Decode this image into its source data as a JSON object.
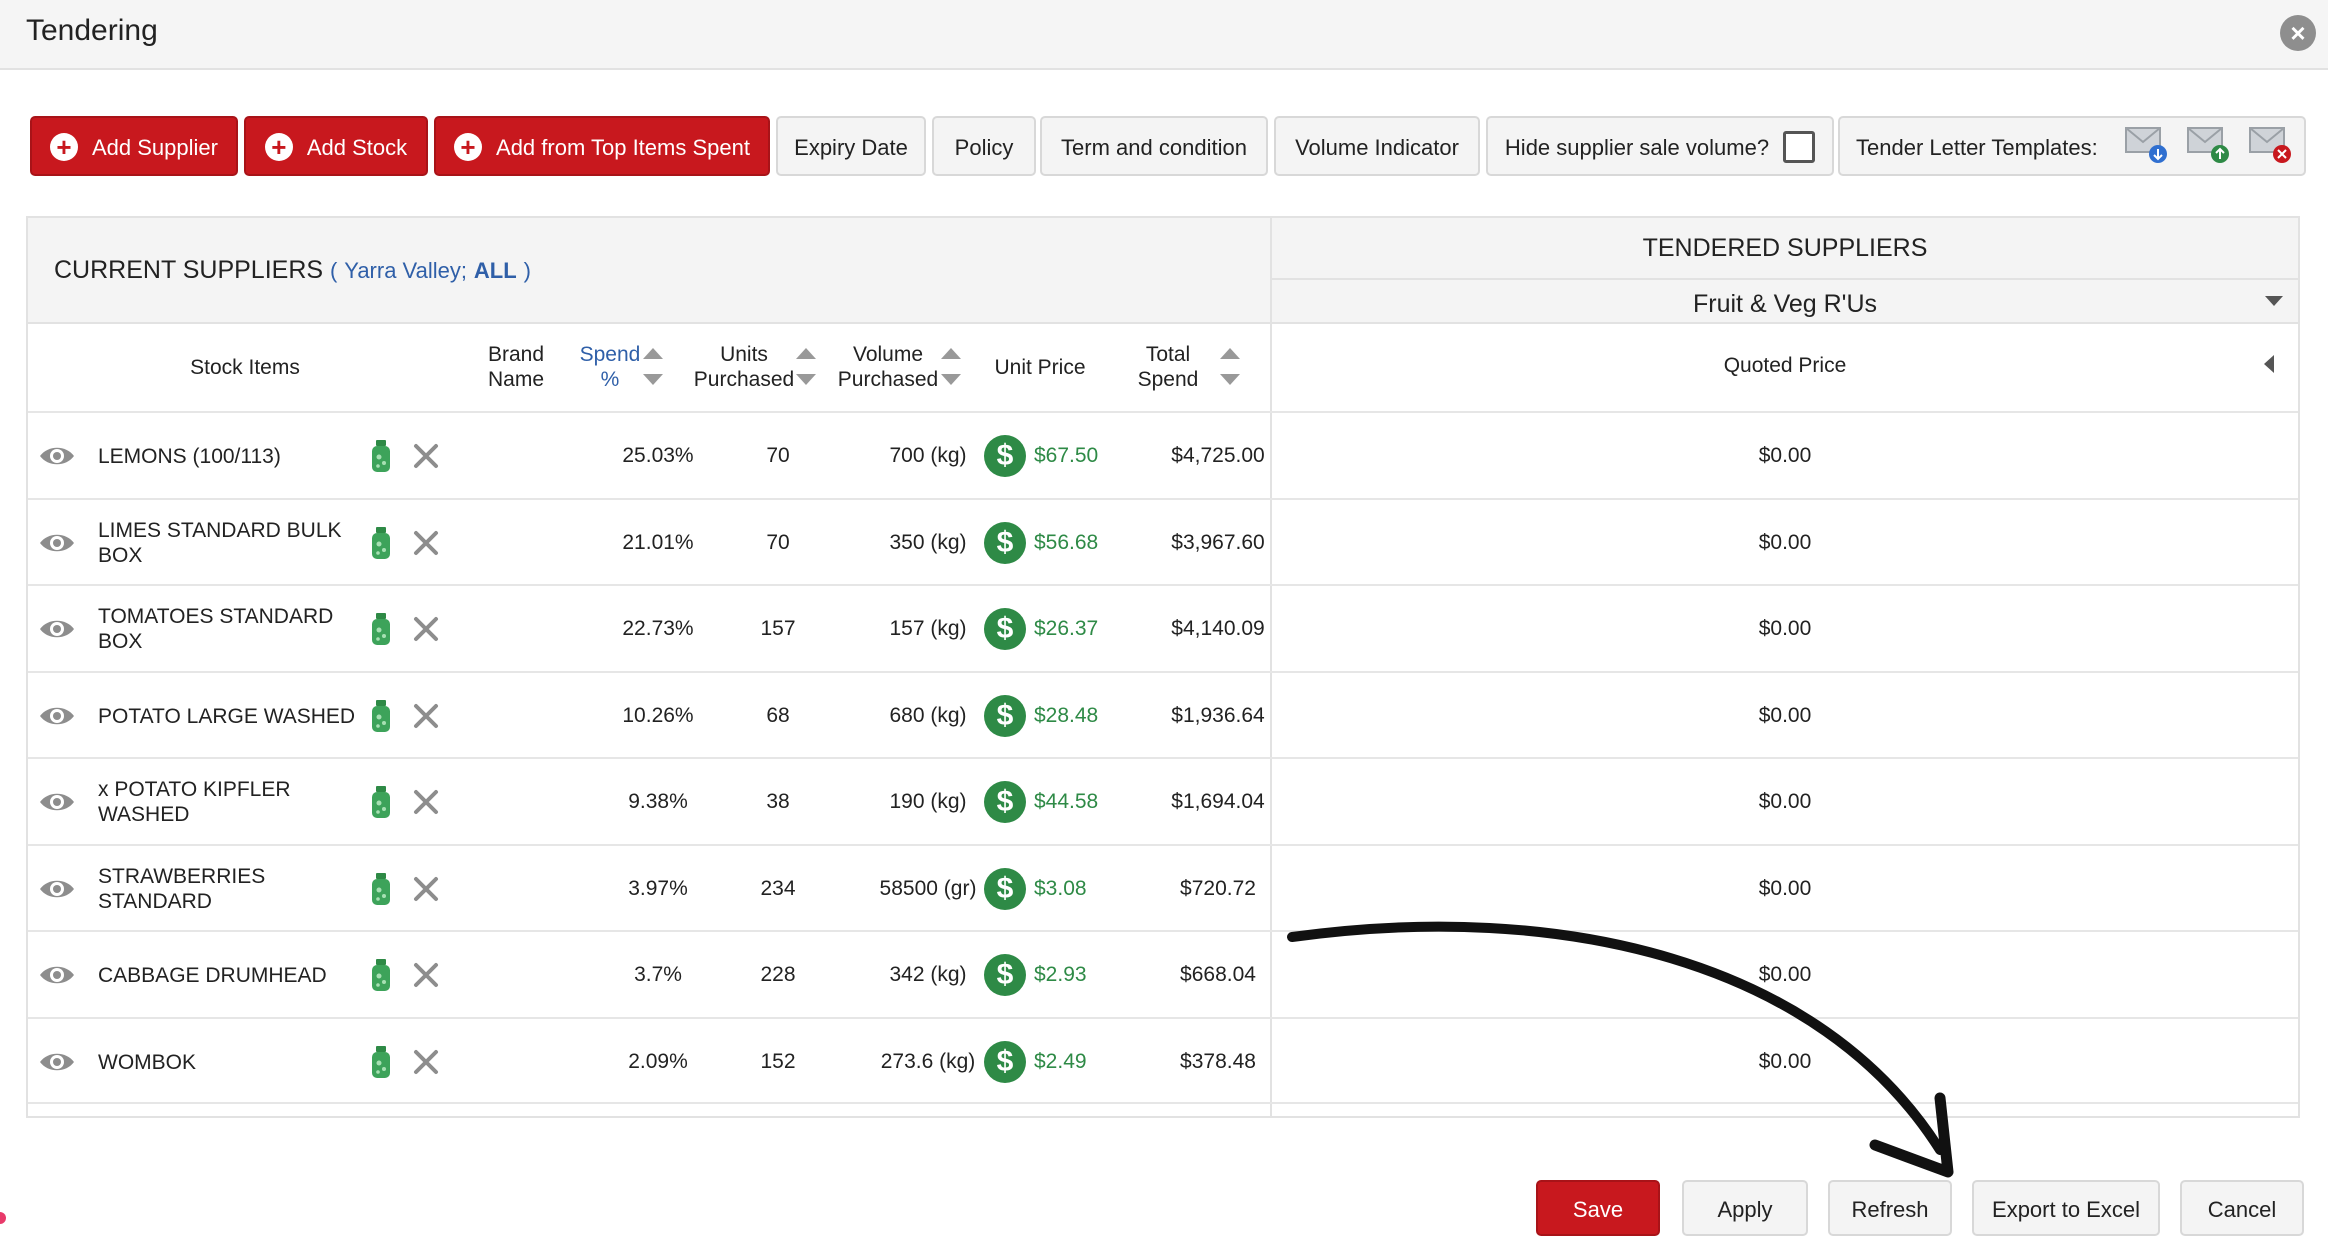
{
  "window": {
    "title": "Tendering",
    "close_glyph": "×"
  },
  "toolbar": {
    "add_supplier": "Add Supplier",
    "add_stock": "Add Stock",
    "add_top_items": "Add from Top Items Spent",
    "expiry_date": "Expiry Date",
    "policy": "Policy",
    "term_condition": "Term and condition",
    "volume_indicator": "Volume Indicator",
    "hide_supplier_volume": "Hide supplier sale volume?",
    "tender_templates": "Tender Letter Templates:"
  },
  "current_suppliers": {
    "label": "CURRENT SUPPLIERS",
    "open_paren": "(",
    "location": "Yarra Valley;",
    "filter": "ALL",
    "close_paren": ")"
  },
  "tendered": {
    "label": "TENDERED SUPPLIERS",
    "supplier": "Fruit & Veg R'Us",
    "quoted_price_header": "Quoted Price"
  },
  "columns": {
    "stock_items": "Stock Items",
    "brand_1": "Brand",
    "brand_2": "Name",
    "spend_1": "Spend",
    "spend_2": "%",
    "units_1": "Units",
    "units_2": "Purchased",
    "volume_1": "Volume",
    "volume_2": "Purchased",
    "unit_price": "Unit Price",
    "total_1": "Total",
    "total_2": "Spend"
  },
  "rows": [
    {
      "name1": "LEMONS (100/113)",
      "name2": "",
      "spend": "25.03%",
      "units": "70",
      "volume": "700 (kg)",
      "unit_price": "$67.50",
      "total": "$4,725.00",
      "quoted": "$0.00"
    },
    {
      "name1": "LIMES STANDARD BULK",
      "name2": "BOX",
      "spend": "21.01%",
      "units": "70",
      "volume": "350 (kg)",
      "unit_price": "$56.68",
      "total": "$3,967.60",
      "quoted": "$0.00"
    },
    {
      "name1": "TOMATOES STANDARD",
      "name2": "BOX",
      "spend": "22.73%",
      "units": "157",
      "volume": "157 (kg)",
      "unit_price": "$26.37",
      "total": "$4,140.09",
      "quoted": "$0.00"
    },
    {
      "name1": "POTATO LARGE WASHED",
      "name2": "",
      "spend": "10.26%",
      "units": "68",
      "volume": "680 (kg)",
      "unit_price": "$28.48",
      "total": "$1,936.64",
      "quoted": "$0.00"
    },
    {
      "name1": "x POTATO KIPFLER",
      "name2": "WASHED",
      "spend": "9.38%",
      "units": "38",
      "volume": "190 (kg)",
      "unit_price": "$44.58",
      "total": "$1,694.04",
      "quoted": "$0.00"
    },
    {
      "name1": "STRAWBERRIES",
      "name2": "STANDARD",
      "spend": "3.97%",
      "units": "234",
      "volume": "58500 (gr)",
      "unit_price": "$3.08",
      "total": "$720.72",
      "quoted": "$0.00"
    },
    {
      "name1": "CABBAGE DRUMHEAD",
      "name2": "",
      "spend": "3.7%",
      "units": "228",
      "volume": "342 (kg)",
      "unit_price": "$2.93",
      "total": "$668.04",
      "quoted": "$0.00"
    },
    {
      "name1": "WOMBOK",
      "name2": "",
      "spend": "2.09%",
      "units": "152",
      "volume": "273.6 (kg)",
      "unit_price": "$2.49",
      "total": "$378.48",
      "quoted": "$0.00"
    }
  ],
  "footer": {
    "save": "Save",
    "apply": "Apply",
    "refresh": "Refresh",
    "export": "Export to Excel",
    "cancel": "Cancel"
  },
  "icons": {
    "plus": "+",
    "dollar": "$",
    "row_icons": [
      "eye-icon",
      "jar-icon",
      "remove-x-icon",
      "dollar-icon"
    ],
    "template_icons": [
      "mail-download-icon",
      "mail-upload-icon",
      "mail-delete-icon"
    ]
  },
  "colors": {
    "primary_red": "#c8181e",
    "price_green": "#2e8a46",
    "link_blue": "#2f5fa8"
  }
}
